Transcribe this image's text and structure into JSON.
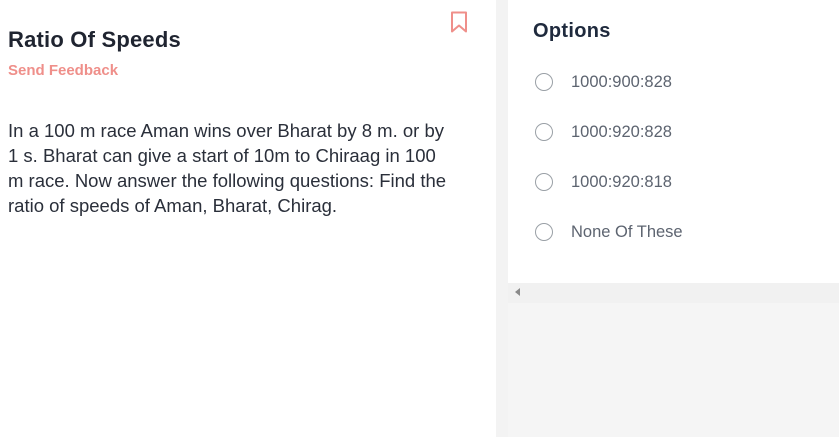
{
  "question": {
    "title": "Ratio Of Speeds",
    "feedback_label": "Send Feedback",
    "text": "In a 100 m race Aman wins over Bharat by 8 m. or by 1 s. Bharat can give a start of 10m to Chiraag in 100 m race. Now answer the following questions: Find the ratio of speeds of Aman, Bharat, Chirag.",
    "bookmark_icon": "bookmark-icon"
  },
  "options": {
    "heading": "Options",
    "items": [
      {
        "label": "1000:900:828"
      },
      {
        "label": "1000:920:828"
      },
      {
        "label": "1000:920:818"
      },
      {
        "label": "None Of These"
      }
    ]
  },
  "colors": {
    "accent": "#ef8f8a",
    "title": "#1f2430",
    "option_text": "#5d6470"
  }
}
